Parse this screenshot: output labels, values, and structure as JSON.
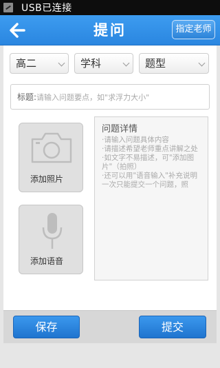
{
  "status_bar": {
    "text": "USB已连接",
    "icon": "usb-notification-icon"
  },
  "header": {
    "title": "提问",
    "back_icon": "back-arrow-icon",
    "assign_teacher": "指定老师"
  },
  "filters": [
    {
      "value": "高二"
    },
    {
      "value": "学科"
    },
    {
      "value": "题型"
    }
  ],
  "title_input": {
    "label": "标题:",
    "placeholder": "请输入问题要点，如\"求浮力大小\""
  },
  "media": {
    "photo": {
      "label": "添加照片",
      "icon": "camera-icon"
    },
    "voice": {
      "label": "添加语音",
      "icon": "microphone-icon"
    }
  },
  "details": {
    "heading": "问题详情",
    "hints": [
      "·请输入问题具体内容",
      "·请描述希望老师重点讲解之处",
      "·如文字不易描述，可\"添加图片\"（拍照）",
      "·还可以用\"语音输入\"补充说明",
      "一次只能提交一个问题，照"
    ]
  },
  "actions": {
    "save": "保存",
    "submit": "提交"
  },
  "colors": {
    "accent": "#2a86e0",
    "header_start": "#3d9cf0",
    "status_bar": "#0d0d0d"
  }
}
